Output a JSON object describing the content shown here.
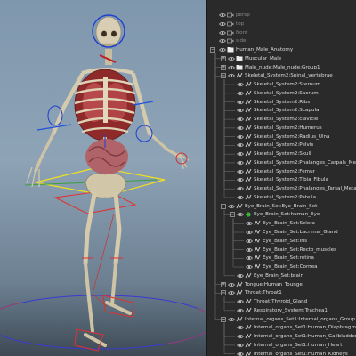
{
  "viewport": {
    "colors": {
      "skyTop": "#7f97ad",
      "skyBottom": "#3e4954",
      "controlBlue": "#2040d0",
      "controlRed": "#e03030",
      "controlYellow": "#f0e020"
    }
  },
  "outliner": {
    "colors": {
      "background": "#2a2a2a",
      "text": "#dcdcdc",
      "cameraText": "#8a8a8a",
      "groupIcon": "#e8e8e8"
    },
    "rows": [
      {
        "label": "persp",
        "depth": 0,
        "type": "camera"
      },
      {
        "label": "top",
        "depth": 0,
        "type": "camera"
      },
      {
        "label": "front",
        "depth": 0,
        "type": "camera"
      },
      {
        "label": "side",
        "depth": 0,
        "type": "camera"
      },
      {
        "label": "Human_Male_Anatomy",
        "depth": 0,
        "type": "group",
        "expander": "-"
      },
      {
        "label": "Muscular_Male",
        "depth": 1,
        "type": "group",
        "expander": "+"
      },
      {
        "label": "Male_nude:Male_nude:Group1",
        "depth": 1,
        "type": "group",
        "expander": "+"
      },
      {
        "label": "Skeletal_System2:Spinal_vertebrae",
        "depth": 1,
        "type": "mesh",
        "expander": "-"
      },
      {
        "label": "Skeletal_System2:Sternum",
        "depth": 2,
        "type": "mesh"
      },
      {
        "label": "Skeletal_System2:Sacrum",
        "depth": 2,
        "type": "mesh"
      },
      {
        "label": "Skeletal_System2:Ribs",
        "depth": 2,
        "type": "mesh"
      },
      {
        "label": "Skeletal_System2:Scapula",
        "depth": 2,
        "type": "mesh"
      },
      {
        "label": "Skeletal_System2:clavicle",
        "depth": 2,
        "type": "mesh"
      },
      {
        "label": "Skeletal_System2:Humerus",
        "depth": 2,
        "type": "mesh"
      },
      {
        "label": "Skeletal_System2:Radius_Ulna",
        "depth": 2,
        "type": "mesh"
      },
      {
        "label": "Skeletal_System2:Pelvis",
        "depth": 2,
        "type": "mesh"
      },
      {
        "label": "Skeletal_System2:Skull",
        "depth": 2,
        "type": "mesh"
      },
      {
        "label": "Skeletal_System2:Phalanges_Carpals_Metac",
        "depth": 2,
        "type": "mesh"
      },
      {
        "label": "Skeletal_System2:Femur",
        "depth": 2,
        "type": "mesh"
      },
      {
        "label": "Skeletal_System2:Tibia_Fibula",
        "depth": 2,
        "type": "mesh"
      },
      {
        "label": "Skeletal_System2:Phalanges_Tarsal_Metatar",
        "depth": 2,
        "type": "mesh"
      },
      {
        "label": "Skeletal_System2:Patella",
        "depth": 2,
        "type": "mesh"
      },
      {
        "label": "Eye_Brain_Set:Eye_Brain_Set",
        "depth": 1,
        "type": "mesh",
        "expander": "-"
      },
      {
        "label": "Eye_Brain_Set:human_Eye",
        "depth": 2,
        "type": "joint",
        "expander": "-"
      },
      {
        "label": "Eye_Brain_Set:Sclera",
        "depth": 3,
        "type": "mesh"
      },
      {
        "label": "Eye_Brain_Set:Lacrimal_Gland",
        "depth": 3,
        "type": "mesh"
      },
      {
        "label": "Eye_Brain_Set:Iris",
        "depth": 3,
        "type": "mesh"
      },
      {
        "label": "Eye_Brain_Set:Recto_muscles",
        "depth": 3,
        "type": "mesh"
      },
      {
        "label": "Eye_Brain_Set:retina",
        "depth": 3,
        "type": "mesh"
      },
      {
        "label": "Eye_Brain_Set:Cornea",
        "depth": 3,
        "type": "mesh"
      },
      {
        "label": "Eye_Brain_Set:brain",
        "depth": 2,
        "type": "mesh"
      },
      {
        "label": "Tongue:Human_Tounge",
        "depth": 1,
        "type": "mesh",
        "expander": "+"
      },
      {
        "label": "Throat:Throat1",
        "depth": 1,
        "type": "mesh",
        "expander": "-"
      },
      {
        "label": "Throat:Thyroid_Gland",
        "depth": 2,
        "type": "mesh"
      },
      {
        "label": "Respiratory_System:Trachea1",
        "depth": 2,
        "type": "mesh"
      },
      {
        "label": "Internal_organs_Set1:Internal_organs_Group",
        "depth": 1,
        "type": "mesh",
        "expander": "-"
      },
      {
        "label": "Internal_organs_Set1:Human_Diaphragm",
        "depth": 2,
        "type": "mesh"
      },
      {
        "label": "Internal_organs_Set1:Human_Gallbladder",
        "depth": 2,
        "type": "mesh"
      },
      {
        "label": "Internal_organs_Set1:Human_Heart",
        "depth": 2,
        "type": "mesh"
      },
      {
        "label": "Internal_organs_Set1:Human_Kidneys",
        "depth": 2,
        "type": "mesh"
      }
    ]
  }
}
